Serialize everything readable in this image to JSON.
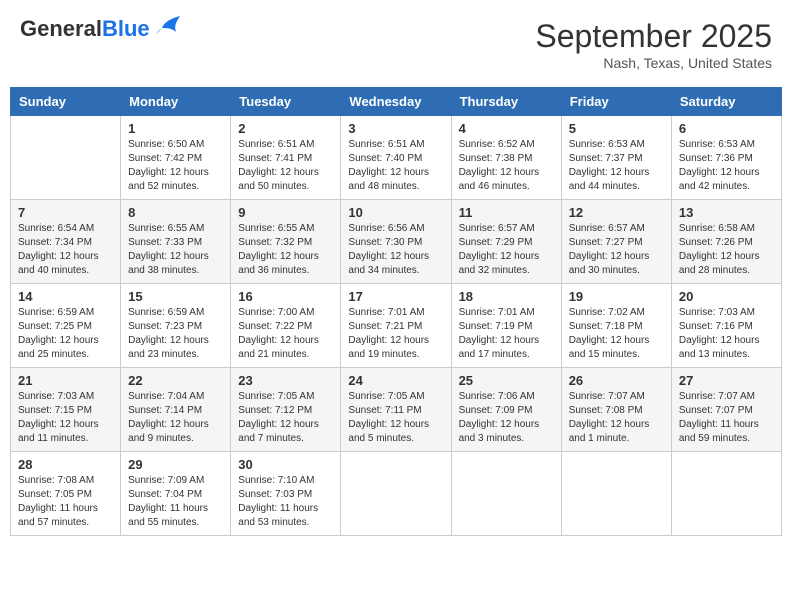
{
  "header": {
    "logo_general": "General",
    "logo_blue": "Blue",
    "month": "September 2025",
    "location": "Nash, Texas, United States"
  },
  "weekdays": [
    "Sunday",
    "Monday",
    "Tuesday",
    "Wednesday",
    "Thursday",
    "Friday",
    "Saturday"
  ],
  "weeks": [
    [
      {
        "day": "",
        "info": ""
      },
      {
        "day": "1",
        "info": "Sunrise: 6:50 AM\nSunset: 7:42 PM\nDaylight: 12 hours\nand 52 minutes."
      },
      {
        "day": "2",
        "info": "Sunrise: 6:51 AM\nSunset: 7:41 PM\nDaylight: 12 hours\nand 50 minutes."
      },
      {
        "day": "3",
        "info": "Sunrise: 6:51 AM\nSunset: 7:40 PM\nDaylight: 12 hours\nand 48 minutes."
      },
      {
        "day": "4",
        "info": "Sunrise: 6:52 AM\nSunset: 7:38 PM\nDaylight: 12 hours\nand 46 minutes."
      },
      {
        "day": "5",
        "info": "Sunrise: 6:53 AM\nSunset: 7:37 PM\nDaylight: 12 hours\nand 44 minutes."
      },
      {
        "day": "6",
        "info": "Sunrise: 6:53 AM\nSunset: 7:36 PM\nDaylight: 12 hours\nand 42 minutes."
      }
    ],
    [
      {
        "day": "7",
        "info": "Sunrise: 6:54 AM\nSunset: 7:34 PM\nDaylight: 12 hours\nand 40 minutes."
      },
      {
        "day": "8",
        "info": "Sunrise: 6:55 AM\nSunset: 7:33 PM\nDaylight: 12 hours\nand 38 minutes."
      },
      {
        "day": "9",
        "info": "Sunrise: 6:55 AM\nSunset: 7:32 PM\nDaylight: 12 hours\nand 36 minutes."
      },
      {
        "day": "10",
        "info": "Sunrise: 6:56 AM\nSunset: 7:30 PM\nDaylight: 12 hours\nand 34 minutes."
      },
      {
        "day": "11",
        "info": "Sunrise: 6:57 AM\nSunset: 7:29 PM\nDaylight: 12 hours\nand 32 minutes."
      },
      {
        "day": "12",
        "info": "Sunrise: 6:57 AM\nSunset: 7:27 PM\nDaylight: 12 hours\nand 30 minutes."
      },
      {
        "day": "13",
        "info": "Sunrise: 6:58 AM\nSunset: 7:26 PM\nDaylight: 12 hours\nand 28 minutes."
      }
    ],
    [
      {
        "day": "14",
        "info": "Sunrise: 6:59 AM\nSunset: 7:25 PM\nDaylight: 12 hours\nand 25 minutes."
      },
      {
        "day": "15",
        "info": "Sunrise: 6:59 AM\nSunset: 7:23 PM\nDaylight: 12 hours\nand 23 minutes."
      },
      {
        "day": "16",
        "info": "Sunrise: 7:00 AM\nSunset: 7:22 PM\nDaylight: 12 hours\nand 21 minutes."
      },
      {
        "day": "17",
        "info": "Sunrise: 7:01 AM\nSunset: 7:21 PM\nDaylight: 12 hours\nand 19 minutes."
      },
      {
        "day": "18",
        "info": "Sunrise: 7:01 AM\nSunset: 7:19 PM\nDaylight: 12 hours\nand 17 minutes."
      },
      {
        "day": "19",
        "info": "Sunrise: 7:02 AM\nSunset: 7:18 PM\nDaylight: 12 hours\nand 15 minutes."
      },
      {
        "day": "20",
        "info": "Sunrise: 7:03 AM\nSunset: 7:16 PM\nDaylight: 12 hours\nand 13 minutes."
      }
    ],
    [
      {
        "day": "21",
        "info": "Sunrise: 7:03 AM\nSunset: 7:15 PM\nDaylight: 12 hours\nand 11 minutes."
      },
      {
        "day": "22",
        "info": "Sunrise: 7:04 AM\nSunset: 7:14 PM\nDaylight: 12 hours\nand 9 minutes."
      },
      {
        "day": "23",
        "info": "Sunrise: 7:05 AM\nSunset: 7:12 PM\nDaylight: 12 hours\nand 7 minutes."
      },
      {
        "day": "24",
        "info": "Sunrise: 7:05 AM\nSunset: 7:11 PM\nDaylight: 12 hours\nand 5 minutes."
      },
      {
        "day": "25",
        "info": "Sunrise: 7:06 AM\nSunset: 7:09 PM\nDaylight: 12 hours\nand 3 minutes."
      },
      {
        "day": "26",
        "info": "Sunrise: 7:07 AM\nSunset: 7:08 PM\nDaylight: 12 hours\nand 1 minute."
      },
      {
        "day": "27",
        "info": "Sunrise: 7:07 AM\nSunset: 7:07 PM\nDaylight: 11 hours\nand 59 minutes."
      }
    ],
    [
      {
        "day": "28",
        "info": "Sunrise: 7:08 AM\nSunset: 7:05 PM\nDaylight: 11 hours\nand 57 minutes."
      },
      {
        "day": "29",
        "info": "Sunrise: 7:09 AM\nSunset: 7:04 PM\nDaylight: 11 hours\nand 55 minutes."
      },
      {
        "day": "30",
        "info": "Sunrise: 7:10 AM\nSunset: 7:03 PM\nDaylight: 11 hours\nand 53 minutes."
      },
      {
        "day": "",
        "info": ""
      },
      {
        "day": "",
        "info": ""
      },
      {
        "day": "",
        "info": ""
      },
      {
        "day": "",
        "info": ""
      }
    ]
  ]
}
